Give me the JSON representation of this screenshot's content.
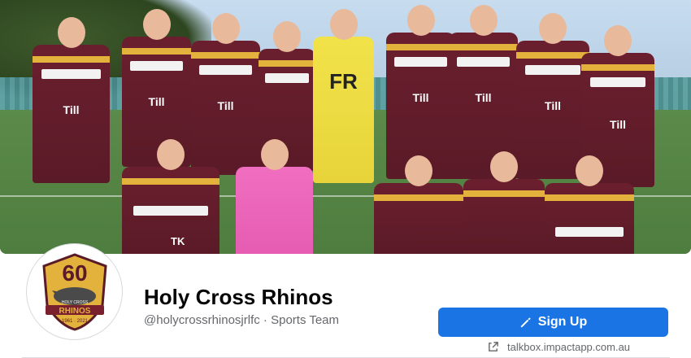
{
  "cover": {
    "jersey_texts": [
      "Till",
      "Till",
      "Till",
      "FR",
      "Till",
      "Till",
      "Till",
      "Till",
      "TK"
    ]
  },
  "avatar": {
    "logo_number": "60",
    "logo_banner": "RHINOS",
    "logo_years": "1961 · 2021",
    "logo_subtext": "HOLY CROSS"
  },
  "page": {
    "name": "Holy Cross Rhinos",
    "meta": "@holycrossrhinosjrlfc · Sports Team"
  },
  "actions": {
    "signup_label": "Sign Up",
    "external_link": "talkbox.impactapp.com.au"
  },
  "colors": {
    "primary_button": "#1b74e4",
    "maroon": "#6b1f2e",
    "gold": "#e3b23c"
  }
}
